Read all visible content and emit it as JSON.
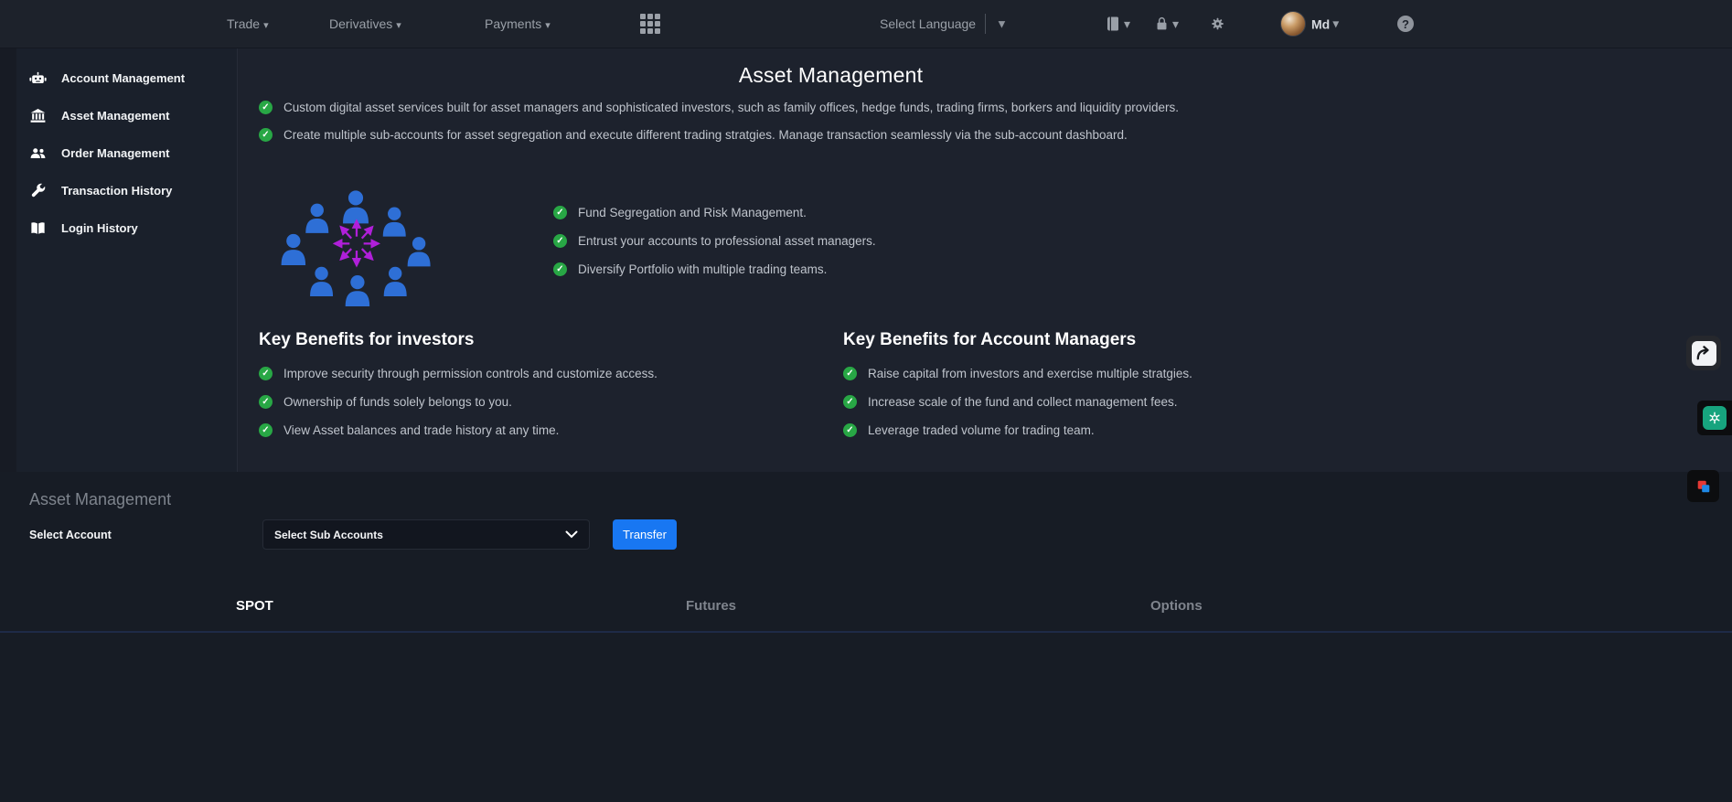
{
  "topnav": {
    "menus": [
      {
        "label": "Trade"
      },
      {
        "label": "Derivatives"
      },
      {
        "label": "Payments"
      }
    ],
    "language_label": "Select Language",
    "username": "Md"
  },
  "glyphs": {
    "caret_down": "▾",
    "triangle_down": "▼",
    "check": "✓",
    "question_mark": "?"
  },
  "sidebar": {
    "items": [
      {
        "label": "Account Management",
        "icon": "robot-icon"
      },
      {
        "label": "Asset Management",
        "icon": "bank-icon"
      },
      {
        "label": "Order Management",
        "icon": "users-icon"
      },
      {
        "label": "Transaction History",
        "icon": "wrench-icon"
      },
      {
        "label": "Login History",
        "icon": "open-book-icon"
      }
    ]
  },
  "main": {
    "title": "Asset Management",
    "intro": [
      "Custom digital asset services built for asset managers and sophisticated investors, such as family offices, hedge funds, trading firms, borkers and liquidity providers.",
      "Create multiple sub-accounts for asset segregation and execute different trading stratgies. Manage transaction seamlessly via the sub-account dashboard."
    ],
    "features": [
      "Fund Segregation and Risk Management.",
      "Entrust your accounts to professional asset managers.",
      "Diversify Portfolio with multiple trading teams."
    ],
    "investors": {
      "title": "Key Benefits for investors",
      "items": [
        "Improve security through permission controls and customize access.",
        "Ownership of funds solely belongs to you.",
        "View Asset balances and trade history at any time."
      ]
    },
    "managers": {
      "title": "Key Benefits for Account Managers",
      "items": [
        "Raise capital from investors and exercise multiple stratgies.",
        "Increase scale of the fund and collect management fees.",
        "Leverage traded volume for trading team."
      ]
    }
  },
  "transfer_panel": {
    "heading": "Asset Management",
    "account_label": "Select Account",
    "dropdown_value": "Select Sub Accounts",
    "transfer_button": "Transfer",
    "tabs": [
      {
        "label": "SPOT",
        "active": true
      },
      {
        "label": "Futures",
        "active": false
      },
      {
        "label": "Options",
        "active": false
      }
    ]
  },
  "colors": {
    "accent_blue": "#1877f2",
    "check_green": "#28a745",
    "person_blue": "#2e6fd6",
    "arrow_purple": "#b01fd9",
    "chatgpt_teal": "#17a47e",
    "topbar_bg": "#1d222b",
    "panel_bg": "#1d222d",
    "sidebar_bg": "#1a202b",
    "bottom_bg": "#171c25"
  }
}
